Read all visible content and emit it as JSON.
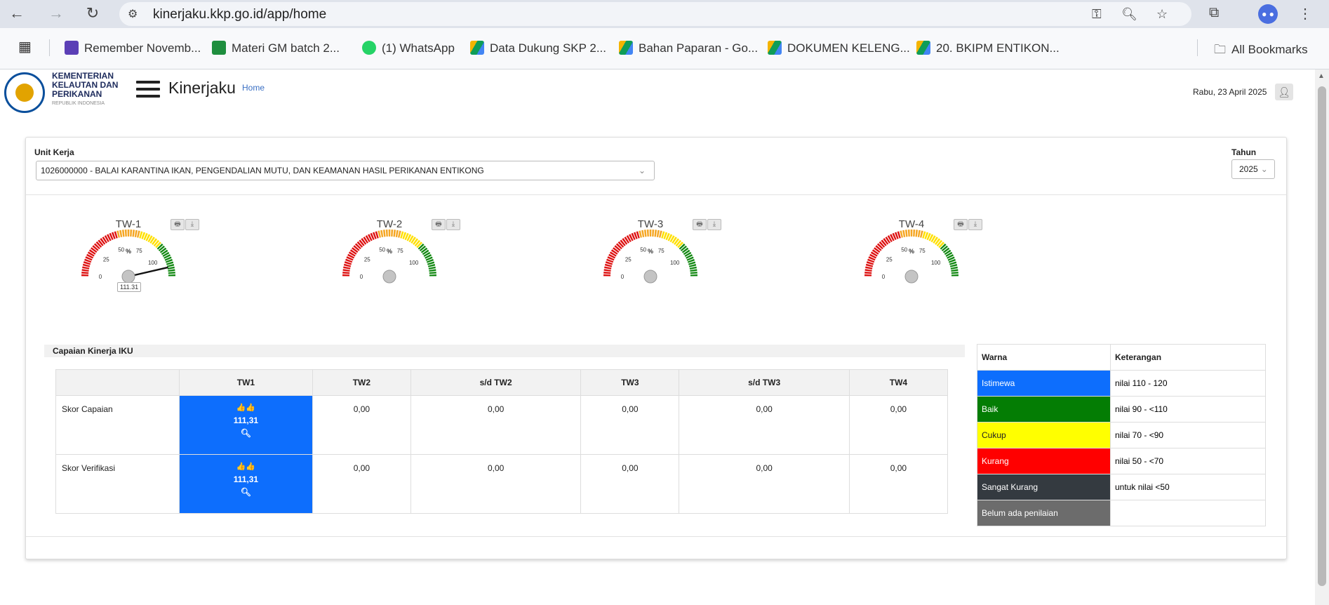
{
  "browser": {
    "url": "kinerjaku.kkp.go.id/app/home",
    "bookmarks": [
      "Remember Novemb...",
      "Materi GM batch 2...",
      "(1) WhatsApp",
      "Data Dukung SKP 2...",
      "Bahan Paparan - Go...",
      "DOKUMEN KELENG...",
      "20. BKIPM ENTIKON..."
    ],
    "all_bookmarks": "All Bookmarks",
    "colors": {
      "bookmark_icons": [
        "#5b3fb6",
        "#1e8e3e",
        "#25d366",
        "#f4b400",
        "#f4b400",
        "#f4b400",
        "#f4b400"
      ]
    }
  },
  "header": {
    "logo_lines": [
      "KEMENTERIAN",
      "KELAUTAN DAN",
      "PERIKANAN"
    ],
    "logo_sub": "REPUBLIK INDONESIA",
    "app_title": "Kinerjaku",
    "breadcrumb": "Home",
    "date": "Rabu, 23 April 2025"
  },
  "filters": {
    "unit_label": "Unit Kerja",
    "unit_value": "1026000000 - BALAI KARANTINA IKAN, PENGENDALIAN MUTU, DAN KEAMANAN HASIL PERIKANAN ENTIKONG",
    "tahun_label": "Tahun",
    "tahun_value": "2025"
  },
  "gauges": [
    {
      "title": "TW-1",
      "value": 111.31,
      "value_label": "111.31",
      "has_value": true
    },
    {
      "title": "TW-2",
      "value": null,
      "value_label": "",
      "has_value": false
    },
    {
      "title": "TW-3",
      "value": null,
      "value_label": "",
      "has_value": false
    },
    {
      "title": "TW-4",
      "value": null,
      "value_label": "",
      "has_value": false
    }
  ],
  "gauge_scale": {
    "ticks": [
      "0",
      "25",
      "50",
      "75",
      "100"
    ],
    "unit": "%",
    "max": 120,
    "colors": {
      "red": "#dd1111",
      "orange": "#f5a623",
      "yellow": "#ffe000",
      "green": "#118811"
    }
  },
  "iku": {
    "title": "Capaian Kinerja IKU",
    "headers": [
      "",
      "TW1",
      "TW2",
      "s/d TW2",
      "TW3",
      "s/d TW3",
      "TW4"
    ],
    "rows": [
      {
        "label": "Skor Capaian",
        "tw1_icons": "👍👍",
        "tw1": "111,31",
        "values": [
          "0,00",
          "0,00",
          "0,00",
          "0,00",
          "0,00"
        ]
      },
      {
        "label": "Skor Verifikasi",
        "tw1_icons": "👍👍",
        "tw1": "111,31",
        "values": [
          "0,00",
          "0,00",
          "0,00",
          "0,00",
          "0,00"
        ]
      }
    ],
    "highlight_color": "#0d6efd"
  },
  "legend": {
    "headers": [
      "Warna",
      "Keterangan"
    ],
    "rows": [
      {
        "warna": "Istimewa",
        "keterangan": "nilai 110 - 120",
        "color": "#0d6efd",
        "text_color": "#ffffff"
      },
      {
        "warna": "Baik",
        "keterangan": "nilai 90 - <110",
        "color": "#047d04",
        "text_color": "#ffffff"
      },
      {
        "warna": "Cukup",
        "keterangan": "nilai 70 - <90",
        "color": "#ffff00",
        "text_color": "#222222"
      },
      {
        "warna": "Kurang",
        "keterangan": "nilai 50 - <70",
        "color": "#ff0000",
        "text_color": "#ffffff"
      },
      {
        "warna": "Sangat Kurang",
        "keterangan": "untuk nilai <50",
        "color": "#343a40",
        "text_color": "#ffffff"
      },
      {
        "warna": "Belum ada penilaian",
        "keterangan": "",
        "color": "#6c6c6c",
        "text_color": "#ffffff"
      }
    ]
  }
}
